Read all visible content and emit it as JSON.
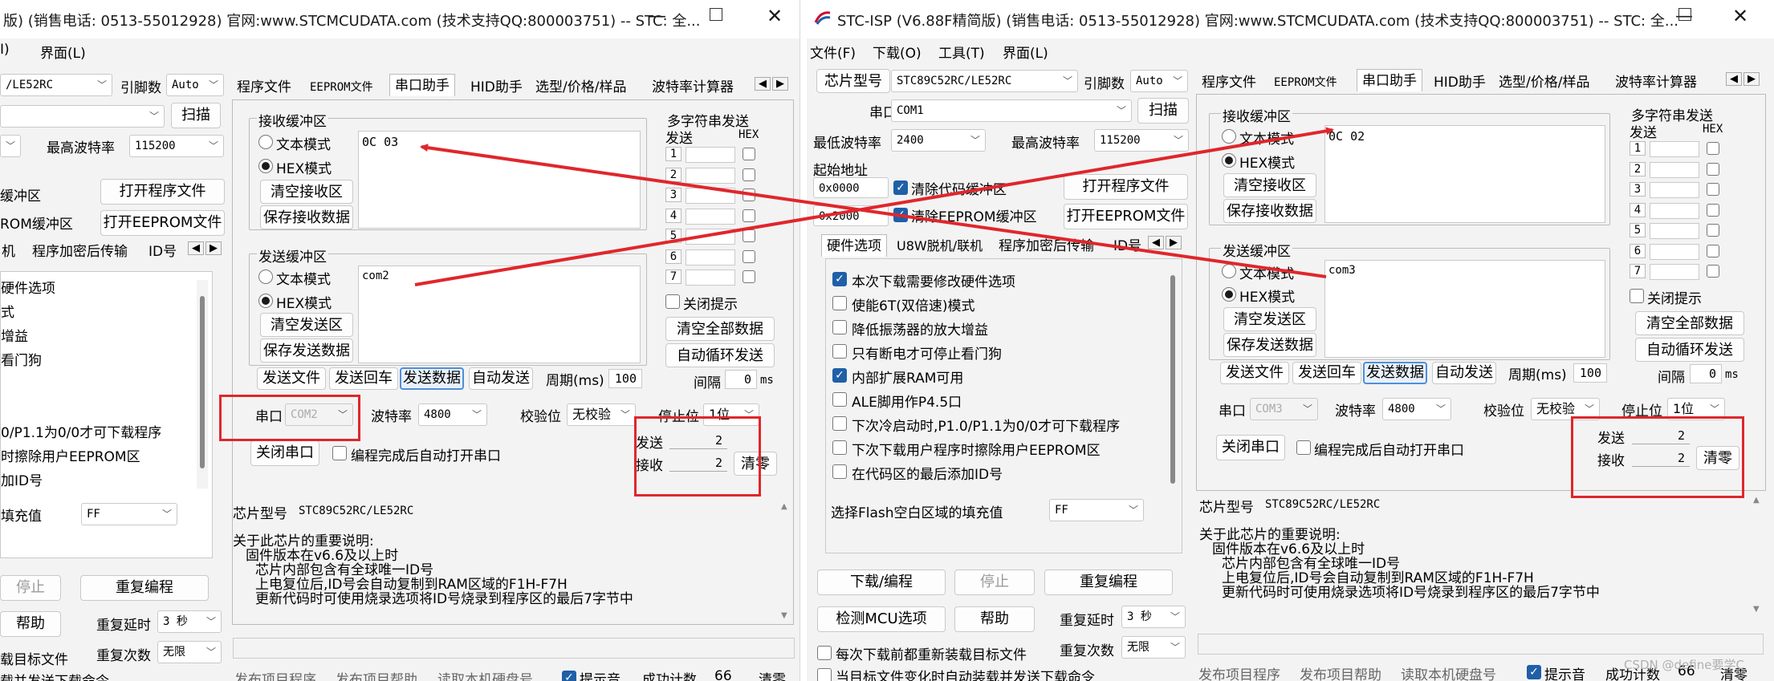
{
  "left": {
    "title": "版) (销售电话: 0513-55012928) 官网:www.STCMCUDATA.com  (技术支持QQ:800003751) -- STC: 全...",
    "menu": [
      "I)",
      "界面(L)"
    ],
    "chip_combo": "/LE52RC",
    "pin_label": "引脚数",
    "pin_value": "Auto",
    "scan": "扫描",
    "maxbaud_label": "最高波特率",
    "maxbaud_value": "115200",
    "clr_code": "缓冲区",
    "clr_eeprom": "ROM缓冲区",
    "open_prog": "打开程序文件",
    "open_eeprom": "打开EEPROM文件",
    "tabs_left": [
      "机",
      "程序加密后传输",
      "ID号"
    ],
    "hw_options": [
      "硬件选项",
      "式",
      "增益",
      "看门狗",
      "",
      "",
      "0/P1.1为0/0才可下载程序",
      "时擦除用户EEPROM区",
      "加ID号"
    ],
    "fill_label": "填充值",
    "fill_value": "FF",
    "stop_btn": "停止",
    "reprogram": "重复编程",
    "help": "帮助",
    "delay_label": "重复延时",
    "delay_value": "3 秒",
    "count_label": "重复次数",
    "count_value": "无限",
    "reload_text": "载目标文件",
    "bottom_cut": "载并发送下载命令",
    "tabs": [
      "程序文件",
      "EEPROM文件",
      "串口助手",
      "HID助手",
      "选型/价格/样品",
      "波特率计算器"
    ],
    "recv_group": "接收缓冲区",
    "recv_text_mode": "文本模式",
    "recv_hex_mode": "HEX模式",
    "recv_clear": "清空接收区",
    "recv_save": "保存接收数据",
    "recv_data": "0C 03",
    "send_group": "发送缓冲区",
    "send_text_mode": "文本模式",
    "send_hex_mode": "HEX模式",
    "send_clear": "清空发送区",
    "send_save": "保存发送数据",
    "send_data": "com2",
    "multi_group": "多字符串发送",
    "multi_send": "发送",
    "multi_hex": "HEX",
    "multi_rows": [
      "1",
      "2",
      "3",
      "4",
      "5",
      "6",
      "7"
    ],
    "close_hint": "关闭提示",
    "clear_all": "清空全部数据",
    "auto_loop": "自动循环发送",
    "interval_label": "间隔",
    "interval_value": "0",
    "interval_unit": "ms",
    "send_file": "发送文件",
    "send_return": "发送回车",
    "send_data_btn": "发送数据",
    "auto_send": "自动发送",
    "period_label": "周期(ms)",
    "period_value": "100",
    "port_label": "串口",
    "port_value": "COM2",
    "baud_label": "波特率",
    "baud_value": "4800",
    "parity_label": "校验位",
    "parity_value": "无校验",
    "stopbit_label": "停止位",
    "stopbit_value": "1位",
    "close_port": "关闭串口",
    "auto_open": "编程完成后自动打开串口",
    "sent_label": "发送",
    "sent_value": "2",
    "recv_label": "接收",
    "recv_value": "2",
    "clear_count": "清零",
    "chip_info_label": "芯片型号",
    "chip_info_value": "STC89C52RC/LE52RC",
    "notes": [
      "关于此芯片的重要说明:",
      "固件版本在v6.6及以上时",
      "芯片内部包含有全球唯一ID号",
      "上电复位后,ID号会自动复制到RAM区域的F1H-F7H",
      "更新代码时可使用烧录选项将ID号烧录到程序区的最后7字节中"
    ],
    "status": [
      "发布项目程序",
      "发布项目帮助",
      "读取本机硬盘号",
      "提示音",
      "成功计数",
      "66",
      "清零"
    ]
  },
  "right": {
    "title": "STC-ISP (V6.88F精简版) (销售电话: 0513-55012928) 官网:www.STCMCUDATA.com  (技术支持QQ:800003751) -- STC: 全...",
    "menu": [
      "文件(F)",
      "下载(O)",
      "工具(T)",
      "界面(L)"
    ],
    "chip_label": "芯片型号",
    "chip_value": "STC89C52RC/LE52RC",
    "pin_label": "引脚数",
    "pin_value": "Auto",
    "port_label": "串口",
    "port_value": "COM1",
    "scan": "扫描",
    "minbaud_label": "最低波特率",
    "minbaud_value": "2400",
    "maxbaud_label": "最高波特率",
    "maxbaud_value": "115200",
    "start_addr": "起始地址",
    "addr1": "0x0000",
    "addr2": "0x2000",
    "clr_code": "清除代码缓冲区",
    "clr_eeprom": "清除EEPROM缓冲区",
    "open_prog": "打开程序文件",
    "open_eeprom": "打开EEPROM文件",
    "tabs_left": [
      "硬件选项",
      "U8W脱机/联机",
      "程序加密后传输",
      "ID号"
    ],
    "hw_options": [
      {
        "label": "本次下载需要修改硬件选项",
        "on": true
      },
      {
        "label": "使能6T(双倍速)模式",
        "on": false
      },
      {
        "label": "降低振荡器的放大增益",
        "on": false
      },
      {
        "label": "只有断电才可停止看门狗",
        "on": false
      },
      {
        "label": "内部扩展RAM可用",
        "on": true
      },
      {
        "label": "ALE脚用作P4.5口",
        "on": false
      },
      {
        "label": "下次冷启动时,P1.0/P1.1为0/0才可下载程序",
        "on": false
      },
      {
        "label": "下次下载用户程序时擦除用户EEPROM区",
        "on": false
      },
      {
        "label": "在代码区的最后添加ID号",
        "on": false
      }
    ],
    "fill_label": "选择Flash空白区域的填充值",
    "fill_value": "FF",
    "download": "下载/编程",
    "stop_btn": "停止",
    "reprogram": "重复编程",
    "check_mcu": "检测MCU选项",
    "help": "帮助",
    "delay_label": "重复延时",
    "delay_value": "3 秒",
    "count_label": "重复次数",
    "count_value": "无限",
    "reload": "每次下载前都重新装载目标文件",
    "auto_reload": "当目标文件变化时自动装载并发送下载命令",
    "tabs": [
      "程序文件",
      "EEPROM文件",
      "串口助手",
      "HID助手",
      "选型/价格/样品",
      "波特率计算器"
    ],
    "recv_group": "接收缓冲区",
    "recv_text_mode": "文本模式",
    "recv_hex_mode": "HEX模式",
    "recv_clear": "清空接收区",
    "recv_save": "保存接收数据",
    "recv_data": "0C 02",
    "send_group": "发送缓冲区",
    "send_text_mode": "文本模式",
    "send_hex_mode": "HEX模式",
    "send_clear": "清空发送区",
    "send_save": "保存发送数据",
    "send_data": "com3",
    "multi_group": "多字符串发送",
    "multi_send": "发送",
    "multi_hex": "HEX",
    "multi_rows": [
      "1",
      "2",
      "3",
      "4",
      "5",
      "6",
      "7"
    ],
    "close_hint": "关闭提示",
    "clear_all": "清空全部数据",
    "auto_loop": "自动循环发送",
    "interval_label": "间隔",
    "interval_value": "0",
    "interval_unit": "ms",
    "send_file": "发送文件",
    "send_return": "发送回车",
    "send_data_btn": "发送数据",
    "auto_send": "自动发送",
    "period_label": "周期(ms)",
    "period_value": "100",
    "port2_label": "串口",
    "port2_value": "COM3",
    "baud_label": "波特率",
    "baud_value": "4800",
    "parity_label": "校验位",
    "parity_value": "无校验",
    "stopbit_label": "停止位",
    "stopbit_value": "1位",
    "close_port": "关闭串口",
    "auto_open": "编程完成后自动打开串口",
    "sent_label": "发送",
    "sent_value": "2",
    "recv_label": "接收",
    "recv_value": "2",
    "clear_count": "清零",
    "chip_info_label": "芯片型号",
    "chip_info_value": "STC89C52RC/LE52RC",
    "notes": [
      "关于此芯片的重要说明:",
      "固件版本在v6.6及以上时",
      "芯片内部包含有全球唯一ID号",
      "上电复位后,ID号会自动复制到RAM区域的F1H-F7H",
      "更新代码时可使用烧录选项将ID号烧录到程序区的最后7字节中"
    ],
    "status": [
      "发布项目程序",
      "发布项目帮助",
      "读取本机硬盘号",
      "提示音",
      "成功计数",
      "66",
      "清零"
    ],
    "watermark": "CSDN @define要学C"
  },
  "colors": {
    "annotation": "#e0262c",
    "accent": "#1f5fa8",
    "bg": "#f3f3f3"
  }
}
